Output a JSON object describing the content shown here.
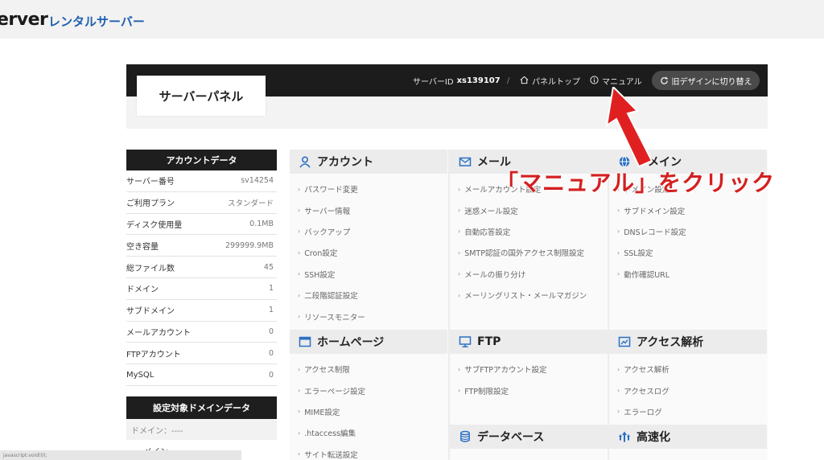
{
  "brand": {
    "logo_partial": "erver",
    "subtitle": "レンタルサーバー"
  },
  "panel": {
    "title": "サーバーパネル",
    "server_id_label": "サーバーID",
    "server_id_value": "xs139107",
    "separator": "/",
    "panel_top": "パネルトップ",
    "manual": "マニュアル",
    "redesign": "旧デザインに切り替え"
  },
  "account": {
    "title": "アカウントデータ",
    "rows": [
      {
        "label": "サーバー番号",
        "value": "sv14254"
      },
      {
        "label": "ご利用プラン",
        "value": "スタンダード"
      },
      {
        "label": "ディスク使用量",
        "value": "0.1MB"
      },
      {
        "label": "空き容量",
        "value": "299999.9MB"
      },
      {
        "label": "総ファイル数",
        "value": "45"
      },
      {
        "label": "ドメイン",
        "value": "1"
      },
      {
        "label": "サブドメイン",
        "value": "1"
      },
      {
        "label": "メールアカウント",
        "value": "0"
      },
      {
        "label": "FTPアカウント",
        "value": "0"
      },
      {
        "label": "MySQL",
        "value": "0"
      }
    ]
  },
  "domain_data": {
    "title": "設定対象ドメインデータ",
    "domain_label": "ドメイン：----",
    "row2": "メイン"
  },
  "sections": {
    "account": {
      "title": "アカウント",
      "items": [
        "パスワード変更",
        "サーバー情報",
        "バックアップ",
        "Cron設定",
        "SSH設定",
        "二段階認証設定",
        "リソースモニター"
      ]
    },
    "mail": {
      "title": "メール",
      "items": [
        "メールアカウント設定",
        "迷惑メール設定",
        "自動応答設定",
        "SMTP認証の国外アクセス制限設定",
        "メールの振り分け",
        "メーリングリスト・メールマガジン"
      ]
    },
    "domain": {
      "title": "ドメイン",
      "items": [
        "ドメイン設定",
        "サブドメイン設定",
        "DNSレコード設定",
        "SSL設定",
        "動作確認URL"
      ]
    },
    "homepage": {
      "title": "ホームページ",
      "items": [
        "アクセス制限",
        "エラーページ設定",
        "MIME設定",
        ".htaccess編集",
        "サイト転送設定"
      ]
    },
    "ftp": {
      "title": "FTP",
      "items": [
        "サブFTPアカウント設定",
        "FTP制限設定"
      ]
    },
    "access": {
      "title": "アクセス解析",
      "items": [
        "アクセス解析",
        "アクセスログ",
        "エラーログ"
      ]
    },
    "database": {
      "title": "データベース"
    },
    "speed": {
      "title": "高速化"
    }
  },
  "annotation": {
    "text": "「マニュアル」をクリック"
  },
  "status_bar": {
    "text": "javascript:void(0);"
  },
  "colors": {
    "header": "#1c1c1c",
    "annotation_red": "#d42020",
    "brand_blue": "#1f5fb0",
    "icon_blue": "#2a6fc4"
  }
}
